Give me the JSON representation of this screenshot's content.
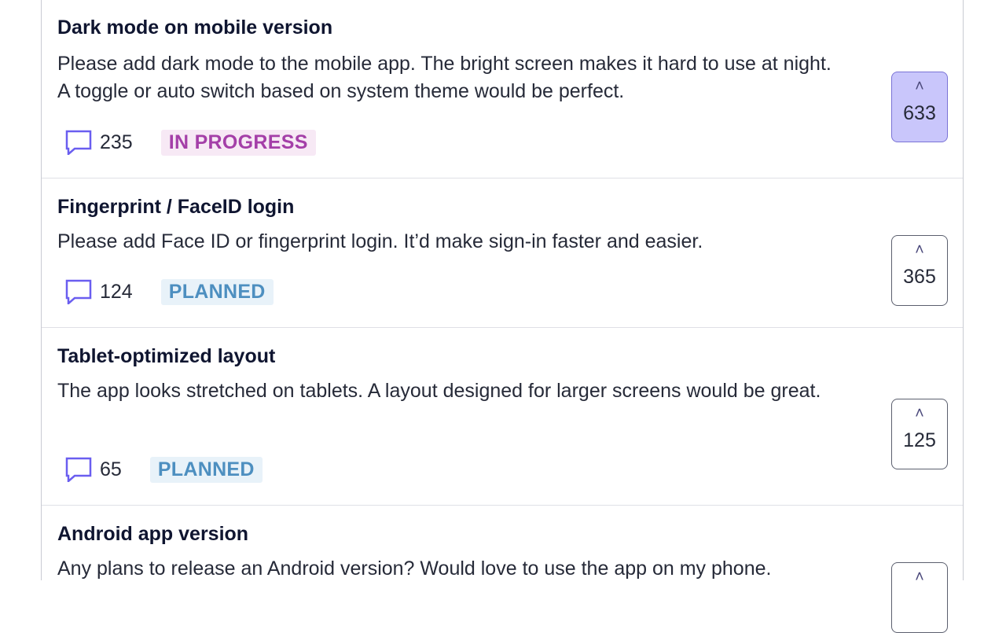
{
  "posts": [
    {
      "title": "Dark mode on mobile version",
      "description": "Please add dark mode to the mobile app. The bright screen makes it hard to use at night. A toggle or auto switch based on system theme would be perfect.",
      "comments": "235",
      "status": "IN PROGRESS",
      "votes": "633",
      "voted": true
    },
    {
      "title": "Fingerprint / FaceID login",
      "description": "Please add Face ID or fingerprint login. It’d make sign-in faster and easier.",
      "comments": "124",
      "status": "PLANNED",
      "votes": "365",
      "voted": false
    },
    {
      "title": "Tablet-optimized layout",
      "description": "The app looks stretched on tablets. A layout designed for larger screens would be great.",
      "comments": "65",
      "status": "PLANNED",
      "votes": "125",
      "voted": false
    },
    {
      "title": "Android app version",
      "description": "Any plans to release an Android version? Would love to use the app on my phone.",
      "comments": "",
      "status": "",
      "votes": "",
      "voted": false
    }
  ],
  "icons": {
    "comment": "comment-bubble-icon",
    "upvote": "chevron-up-icon"
  },
  "colors": {
    "accent": "#6a5ef0",
    "vote_active_bg": "#c9c6fb",
    "in_progress_text": "#a43fa8",
    "in_progress_bg": "#f7e9f5",
    "planned_text": "#4d8fc0",
    "planned_bg": "#e8f2f9"
  }
}
